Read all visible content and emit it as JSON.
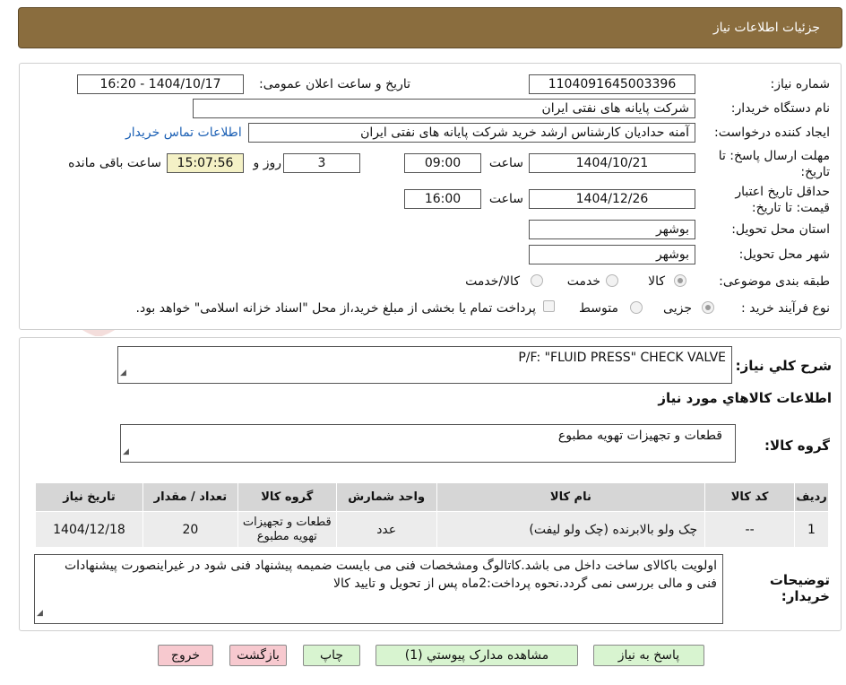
{
  "header": {
    "title": "جزئیات اطلاعات نیاز"
  },
  "info": {
    "need_number_label": "شماره نیاز:",
    "need_number": "1104091645003396",
    "announce_label": "تاریخ و ساعت اعلان عمومی:",
    "announce_value": "1404/10/17 - 16:20",
    "buyer_org_label": "نام دستگاه خریدار:",
    "buyer_org": "شرکت پایانه های نفتی ایران",
    "requester_label": "ایجاد کننده درخواست:",
    "requester": "آمنه  حدادیان  کارشناس ارشد خرید  شرکت پایانه های نفتی ایران",
    "contact_link": "اطلاعات تماس خریدار",
    "deadline_label_1": "مهلت ارسال پاسخ: تا",
    "deadline_label_2": "تاریخ:",
    "deadline_date": "1404/10/21",
    "time_label": "ساعت",
    "deadline_time": "09:00",
    "days_value": "3",
    "days_label": "روز و",
    "remaining_time": "15:07:56",
    "remaining_label": "ساعت باقی مانده",
    "validity_label_1": "حداقل تاریخ اعتبار",
    "validity_label_2": "قیمت: تا تاریخ:",
    "validity_date": "1404/12/26",
    "validity_time": "16:00",
    "province_label": "استان محل تحویل:",
    "province": "بوشهر",
    "city_label": "شهر محل تحویل:",
    "city": "بوشهر",
    "category_label": "طبقه بندی موضوعی:",
    "category_options": [
      "کالا",
      "خدمت",
      "کالا/خدمت"
    ],
    "process_label": "نوع فرآیند خرید :",
    "process_options": [
      "جزیی",
      "متوسط"
    ],
    "payment_note": "پرداخت تمام یا بخشی از مبلغ خرید،از محل \"اسناد خزانه اسلامی\" خواهد بود."
  },
  "need": {
    "summary_label": "شرح کلي نياز:",
    "summary_value": "P/F: \"FLUID PRESS\" CHECK VALVE",
    "goods_info_title": "اطلاعات کالاهاي مورد نياز",
    "goods_group_label": "گروه کالا:",
    "goods_group_value": "قطعات و تجهیزات تهویه مطبوع"
  },
  "table": {
    "headers": [
      "ردیف",
      "کد کالا",
      "نام کالا",
      "واحد شمارش",
      "گروه کالا",
      "تعداد / مقدار",
      "تاریخ نیاز"
    ],
    "rows": [
      [
        "1",
        "--",
        "چک ولو بالابرنده (چک ولو لیفت)",
        "عدد",
        "قطعات و تجهیزات تهویه مطبوع",
        "20",
        "1404/12/18"
      ]
    ]
  },
  "notes": {
    "label_1": "توضیحات",
    "label_2": "خریدار:",
    "text": "اولویت باکالای ساخت داخل می باشد.کاتالوگ ومشخصات فنی می بایست ضمیمه پیشنهاد فنی شود در غیراینصورت پیشنهادات فنی و مالی بررسی نمی گردد.نحوه پرداخت:2ماه پس از تحویل و تایید کالا"
  },
  "buttons": {
    "reply": "پاسخ به نیاز",
    "attachments": "مشاهده مدارک پیوستي (1)",
    "print": "چاپ",
    "back": "بازگشت",
    "exit": "خروج"
  }
}
